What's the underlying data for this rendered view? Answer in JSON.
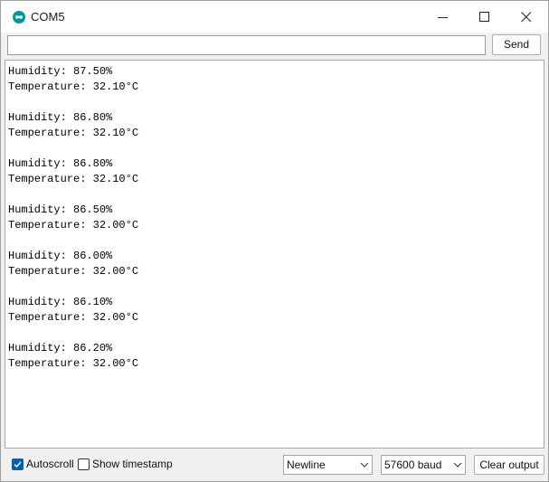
{
  "window": {
    "title": "COM5",
    "app_icon": "arduino-infinity-icon"
  },
  "title_controls": {
    "minimize_icon": "minimize-icon",
    "maximize_icon": "maximize-icon",
    "close_icon": "close-icon"
  },
  "send_bar": {
    "input_value": "",
    "input_placeholder": "",
    "send_label": "Send"
  },
  "output": {
    "lines": [
      "Humidity: 87.50%",
      "Temperature: 32.10°C",
      "",
      "Humidity: 86.80%",
      "Temperature: 32.10°C",
      "",
      "Humidity: 86.80%",
      "Temperature: 32.10°C",
      "",
      "Humidity: 86.50%",
      "Temperature: 32.00°C",
      "",
      "Humidity: 86.00%",
      "Temperature: 32.00°C",
      "",
      "Humidity: 86.10%",
      "Temperature: 32.00°C",
      "",
      "Humidity: 86.20%",
      "Temperature: 32.00°C"
    ]
  },
  "footer": {
    "autoscroll": {
      "label": "Autoscroll",
      "checked": true
    },
    "show_timestamp": {
      "label": "Show timestamp",
      "checked": false
    },
    "line_ending": {
      "selected": "Newline"
    },
    "baud_rate": {
      "selected": "57600 baud"
    },
    "clear_label": "Clear output"
  },
  "colors": {
    "accent": "#005fb8",
    "arduino_teal": "#00979c",
    "chrome_background": "#f0f0f0",
    "output_background": "#ffffff"
  }
}
